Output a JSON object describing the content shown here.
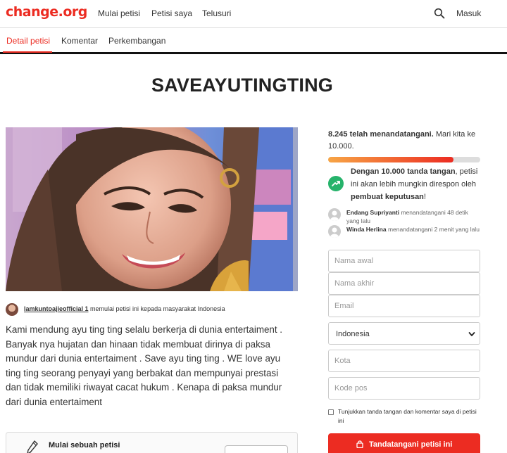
{
  "header": {
    "logo": "change.org",
    "nav": [
      "Mulai petisi",
      "Petisi saya",
      "Telusuri"
    ],
    "login": "Masuk"
  },
  "tabs": [
    "Detail petisi",
    "Komentar",
    "Perkembangan"
  ],
  "petition": {
    "title": "SAVEAYUTINGTING",
    "starter_name": "lamkuntoajieofficial 1",
    "starter_suffix": " memulai petisi ini kepada masyarakat Indonesia",
    "body": "Kami mendung ayu ting ting selalu berkerja di dunia entertaiment . Banyak nya hujatan dan hinaan tidak membuat dirinya di paksa mundur dari dunia entertaiment . Save ayu ting ting . WE love ayu ting ting seorang penyayi yang berbakat dan mempunyai prestasi dan tidak memiliki riwayat cacat hukum . Kenapa di paksa mundur dari dunia entertaiment",
    "start_box_label": "Mulai sebuah petisi"
  },
  "sidebar": {
    "count_strong": "8.245 telah menandatangani.",
    "count_rest": " Mari kita ke 10.000.",
    "progress_percent": 82.45,
    "goal_strong": "Dengan 10.000 tanda tangan",
    "goal_mid": ", petisi ini akan lebih mungkin direspon oleh ",
    "goal_strong2": "pembuat keputusan",
    "goal_end": "!",
    "signers": [
      {
        "name": "Endang Supriyanti",
        "action": " menandatangani 48 detik yang lalu"
      },
      {
        "name": "Winda Herlina",
        "action": " menandatangani 2 menit yang lalu"
      }
    ]
  },
  "form": {
    "first_name_placeholder": "Nama awal",
    "last_name_placeholder": "Nama akhir",
    "email_placeholder": "Email",
    "country": "Indonesia",
    "city_placeholder": "Kota",
    "postal_placeholder": "Kode pos",
    "consent": "Tunjukkan tanda tangan dan komentar saya di petisi ini",
    "sign_button": "Tandatangani petisi ini"
  },
  "colors": {
    "brand": "#ec2c22",
    "goal_icon": "#26b36b"
  }
}
